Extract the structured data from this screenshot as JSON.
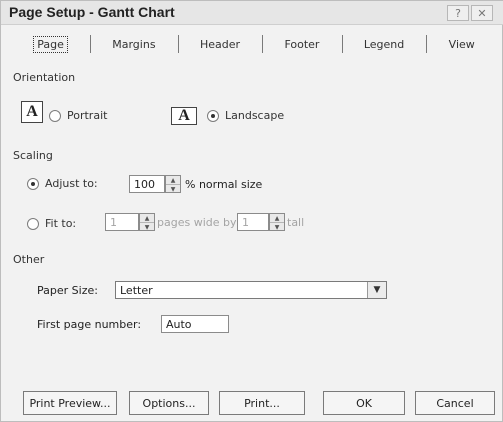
{
  "window": {
    "title": "Page Setup - Gantt Chart",
    "help_label": "?",
    "close_label": "✕"
  },
  "tabs": [
    "Page",
    "Margins",
    "Header",
    "Footer",
    "Legend",
    "View"
  ],
  "orientation": {
    "label": "Orientation",
    "icon_glyph": "A",
    "portrait_label": "Portrait",
    "landscape_label": "Landscape",
    "selected": "Landscape"
  },
  "scaling": {
    "label": "Scaling",
    "adjust_label": "Adjust to:",
    "adjust_value": "100",
    "adjust_suffix": "% normal size",
    "fit_label": "Fit to:",
    "fit_wide_value": "1",
    "fit_wide_suffix": "pages wide by",
    "fit_tall_value": "1",
    "fit_tall_suffix": "tall",
    "selected": "Adjust to"
  },
  "other": {
    "label": "Other",
    "paper_size_label": "Paper Size:",
    "paper_size_value": "Letter",
    "first_page_label": "First page number:",
    "first_page_value": "Auto"
  },
  "buttons": {
    "print_preview": "Print Preview...",
    "options": "Options...",
    "print": "Print...",
    "ok": "OK",
    "cancel": "Cancel"
  },
  "icons": {
    "help": "help-icon",
    "close": "close-icon",
    "spin": "spinner-arrows-icon",
    "dropdown": "chevron-down-icon"
  }
}
